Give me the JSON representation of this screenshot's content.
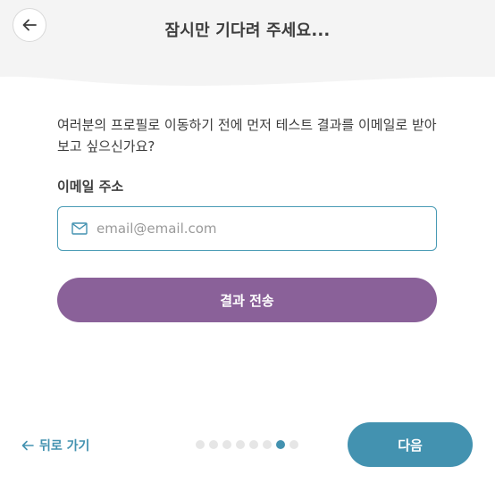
{
  "header": {
    "title": "잠시만 기다려 주세요...",
    "back_icon": "arrow-left-icon"
  },
  "main": {
    "prompt": "여러분의 프로필로 이동하기 전에 먼저 테스트 결과를 이메일로 받아 보고 싶으신가요?",
    "email_label": "이메일 주소",
    "email_placeholder": "email@email.com",
    "email_value": "",
    "email_icon": "envelope-icon",
    "submit_label": "결과 전송"
  },
  "footer": {
    "back_label": "뒤로 가기",
    "back_icon": "arrow-left-icon",
    "progress": {
      "total_steps": 8,
      "current_step": 7
    },
    "next_label": "다음"
  },
  "colors": {
    "header_bg": "#f4f4f4",
    "accent_teal": "#4392b0",
    "submit_purple": "#8a6199",
    "input_border": "#4a9bb5",
    "dot_inactive": "#e6e6e6"
  }
}
